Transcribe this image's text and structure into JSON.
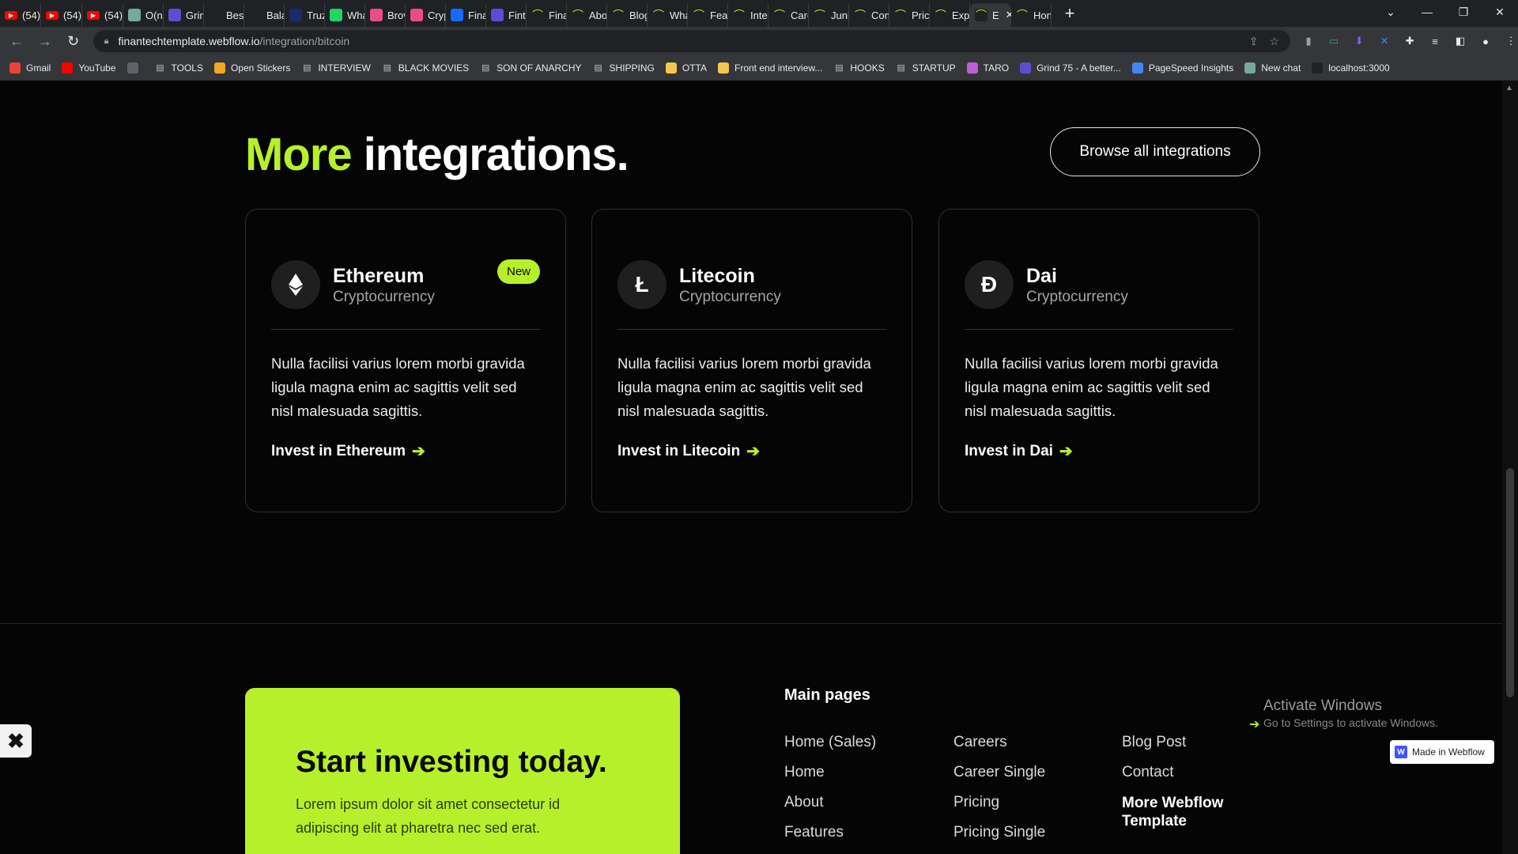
{
  "tabs": [
    {
      "label": "(54)",
      "fav": "youtube-icon",
      "color": "#ff0000"
    },
    {
      "label": "(54)",
      "fav": "youtube-icon",
      "color": "#ff0000"
    },
    {
      "label": "(54)",
      "fav": "youtube-icon",
      "color": "#ff0000"
    },
    {
      "label": "O(n)",
      "fav": "chatgpt-icon",
      "color": "#74aa9c"
    },
    {
      "label": "Grin",
      "fav": "grind75-icon",
      "color": "#5a4fcf"
    },
    {
      "label": "Best",
      "fav": "binance-icon",
      "color": "#202124"
    },
    {
      "label": "Bala",
      "fav": "binance-icon",
      "color": "#202124"
    },
    {
      "label": "Truz",
      "fav": "dot-icon",
      "color": "#1a2a6c"
    },
    {
      "label": "Wha",
      "fav": "whatsapp-icon",
      "color": "#25d366"
    },
    {
      "label": "Brov",
      "fav": "dribbble-icon",
      "color": "#ea4c89"
    },
    {
      "label": "Cryp",
      "fav": "dribbble-icon",
      "color": "#ea4c89"
    },
    {
      "label": "Fina",
      "fav": "behance-icon",
      "color": "#1769ff"
    },
    {
      "label": "Fint",
      "fav": "dots-icon",
      "color": "#5c4bd9"
    },
    {
      "label": "Fina",
      "fav": "finantech-icon",
      "color": "#202124"
    },
    {
      "label": "Abo",
      "fav": "finantech-icon",
      "color": "#202124"
    },
    {
      "label": "Blog",
      "fav": "finantech-icon",
      "color": "#202124"
    },
    {
      "label": "Wha",
      "fav": "finantech-icon",
      "color": "#202124"
    },
    {
      "label": "Feat",
      "fav": "finantech-icon",
      "color": "#202124"
    },
    {
      "label": "Inte",
      "fav": "finantech-icon",
      "color": "#202124"
    },
    {
      "label": "Care",
      "fav": "finantech-icon",
      "color": "#202124"
    },
    {
      "label": "Juni",
      "fav": "finantech-icon",
      "color": "#202124"
    },
    {
      "label": "Con",
      "fav": "finantech-icon",
      "color": "#202124"
    },
    {
      "label": "Prici",
      "fav": "finantech-icon",
      "color": "#202124"
    },
    {
      "label": "Expe",
      "fav": "finantech-icon",
      "color": "#202124"
    },
    {
      "label": "E",
      "fav": "finantech-icon",
      "color": "#202124",
      "active": true
    },
    {
      "label": "Hon",
      "fav": "finantech-icon",
      "color": "#202124"
    }
  ],
  "omnibox": {
    "domain": "finantechtemplate.webflow.io",
    "path": "/integration/bitcoin"
  },
  "bookmarks": [
    {
      "label": "Gmail",
      "icon": "gmail-icon",
      "color": "#ea4335"
    },
    {
      "label": "YouTube",
      "icon": "youtube-icon",
      "color": "#ff0000"
    },
    {
      "label": "",
      "icon": "globe-icon",
      "color": "#5f6368"
    },
    {
      "label": "TOOLS",
      "icon": "folder-icon",
      "color": "#5f6368"
    },
    {
      "label": "Open Stickers",
      "icon": "sticker-icon",
      "color": "#f5a623"
    },
    {
      "label": "INTERVIEW",
      "icon": "folder-icon",
      "color": "#5f6368"
    },
    {
      "label": "BLACK MOVIES",
      "icon": "folder-icon",
      "color": "#5f6368"
    },
    {
      "label": "SON OF ANARCHY",
      "icon": "folder-icon",
      "color": "#5f6368"
    },
    {
      "label": "SHIPPING",
      "icon": "folder-icon",
      "color": "#5f6368"
    },
    {
      "label": "OTTA",
      "icon": "otta-icon",
      "color": "#f2c94c"
    },
    {
      "label": "Front end interview...",
      "icon": "bookmark-icon",
      "color": "#f2c94c"
    },
    {
      "label": "HOOKS",
      "icon": "folder-icon",
      "color": "#5f6368"
    },
    {
      "label": "STARTUP",
      "icon": "folder-icon",
      "color": "#5f6368"
    },
    {
      "label": "TARO",
      "icon": "taro-icon",
      "color": "#c05ed6"
    },
    {
      "label": "Grind 75 - A better...",
      "icon": "grind75-icon",
      "color": "#5a4fcf"
    },
    {
      "label": "PageSpeed Insights",
      "icon": "pagespeed-icon",
      "color": "#4285f4"
    },
    {
      "label": "New chat",
      "icon": "chatgpt-icon",
      "color": "#74aa9c"
    },
    {
      "label": "localhost:3000",
      "icon": "localhost-icon",
      "color": "#202124"
    }
  ],
  "section": {
    "title_accent": "More",
    "title_rest": " integrations.",
    "browse_label": "Browse all integrations"
  },
  "cards": [
    {
      "name": "Ethereum",
      "category": "Cryptocurrency",
      "symbol": "◆",
      "badge": "New",
      "description": "Nulla facilisi varius lorem morbi gravida ligula magna enim ac sagittis velit sed nisl malesuada sagittis.",
      "cta": "Invest in Ethereum"
    },
    {
      "name": "Litecoin",
      "category": "Cryptocurrency",
      "symbol": "Ł",
      "badge": "",
      "description": "Nulla facilisi varius lorem morbi gravida ligula magna enim ac sagittis velit sed nisl malesuada sagittis.",
      "cta": "Invest in Litecoin"
    },
    {
      "name": "Dai",
      "category": "Cryptocurrency",
      "symbol": "Đ",
      "badge": "",
      "description": "Nulla facilisi varius lorem morbi gravida ligula magna enim ac sagittis velit sed nisl malesuada sagittis.",
      "cta": "Invest in Dai"
    }
  ],
  "footer": {
    "cta_title": "Start investing today.",
    "cta_text": "Lorem ipsum dolor sit amet consectetur id adipiscing elit at pharetra nec sed erat.",
    "main_pages_title": "Main pages",
    "col1": [
      "Home (Sales)",
      "Home",
      "About",
      "Features"
    ],
    "col2": [
      "Careers",
      "Career Single",
      "Pricing",
      "Pricing Single"
    ],
    "col3": [
      "Blog Post",
      "Contact"
    ],
    "more_template": "More Webflow Template"
  },
  "overlay": {
    "activate_title": "Activate Windows",
    "activate_sub": "Go to Settings to activate Windows.",
    "made_in_webflow": "Made in Webflow"
  },
  "colors": {
    "accent": "#b6f02b",
    "background": "#050505",
    "card_border": "#2e2e2e"
  }
}
